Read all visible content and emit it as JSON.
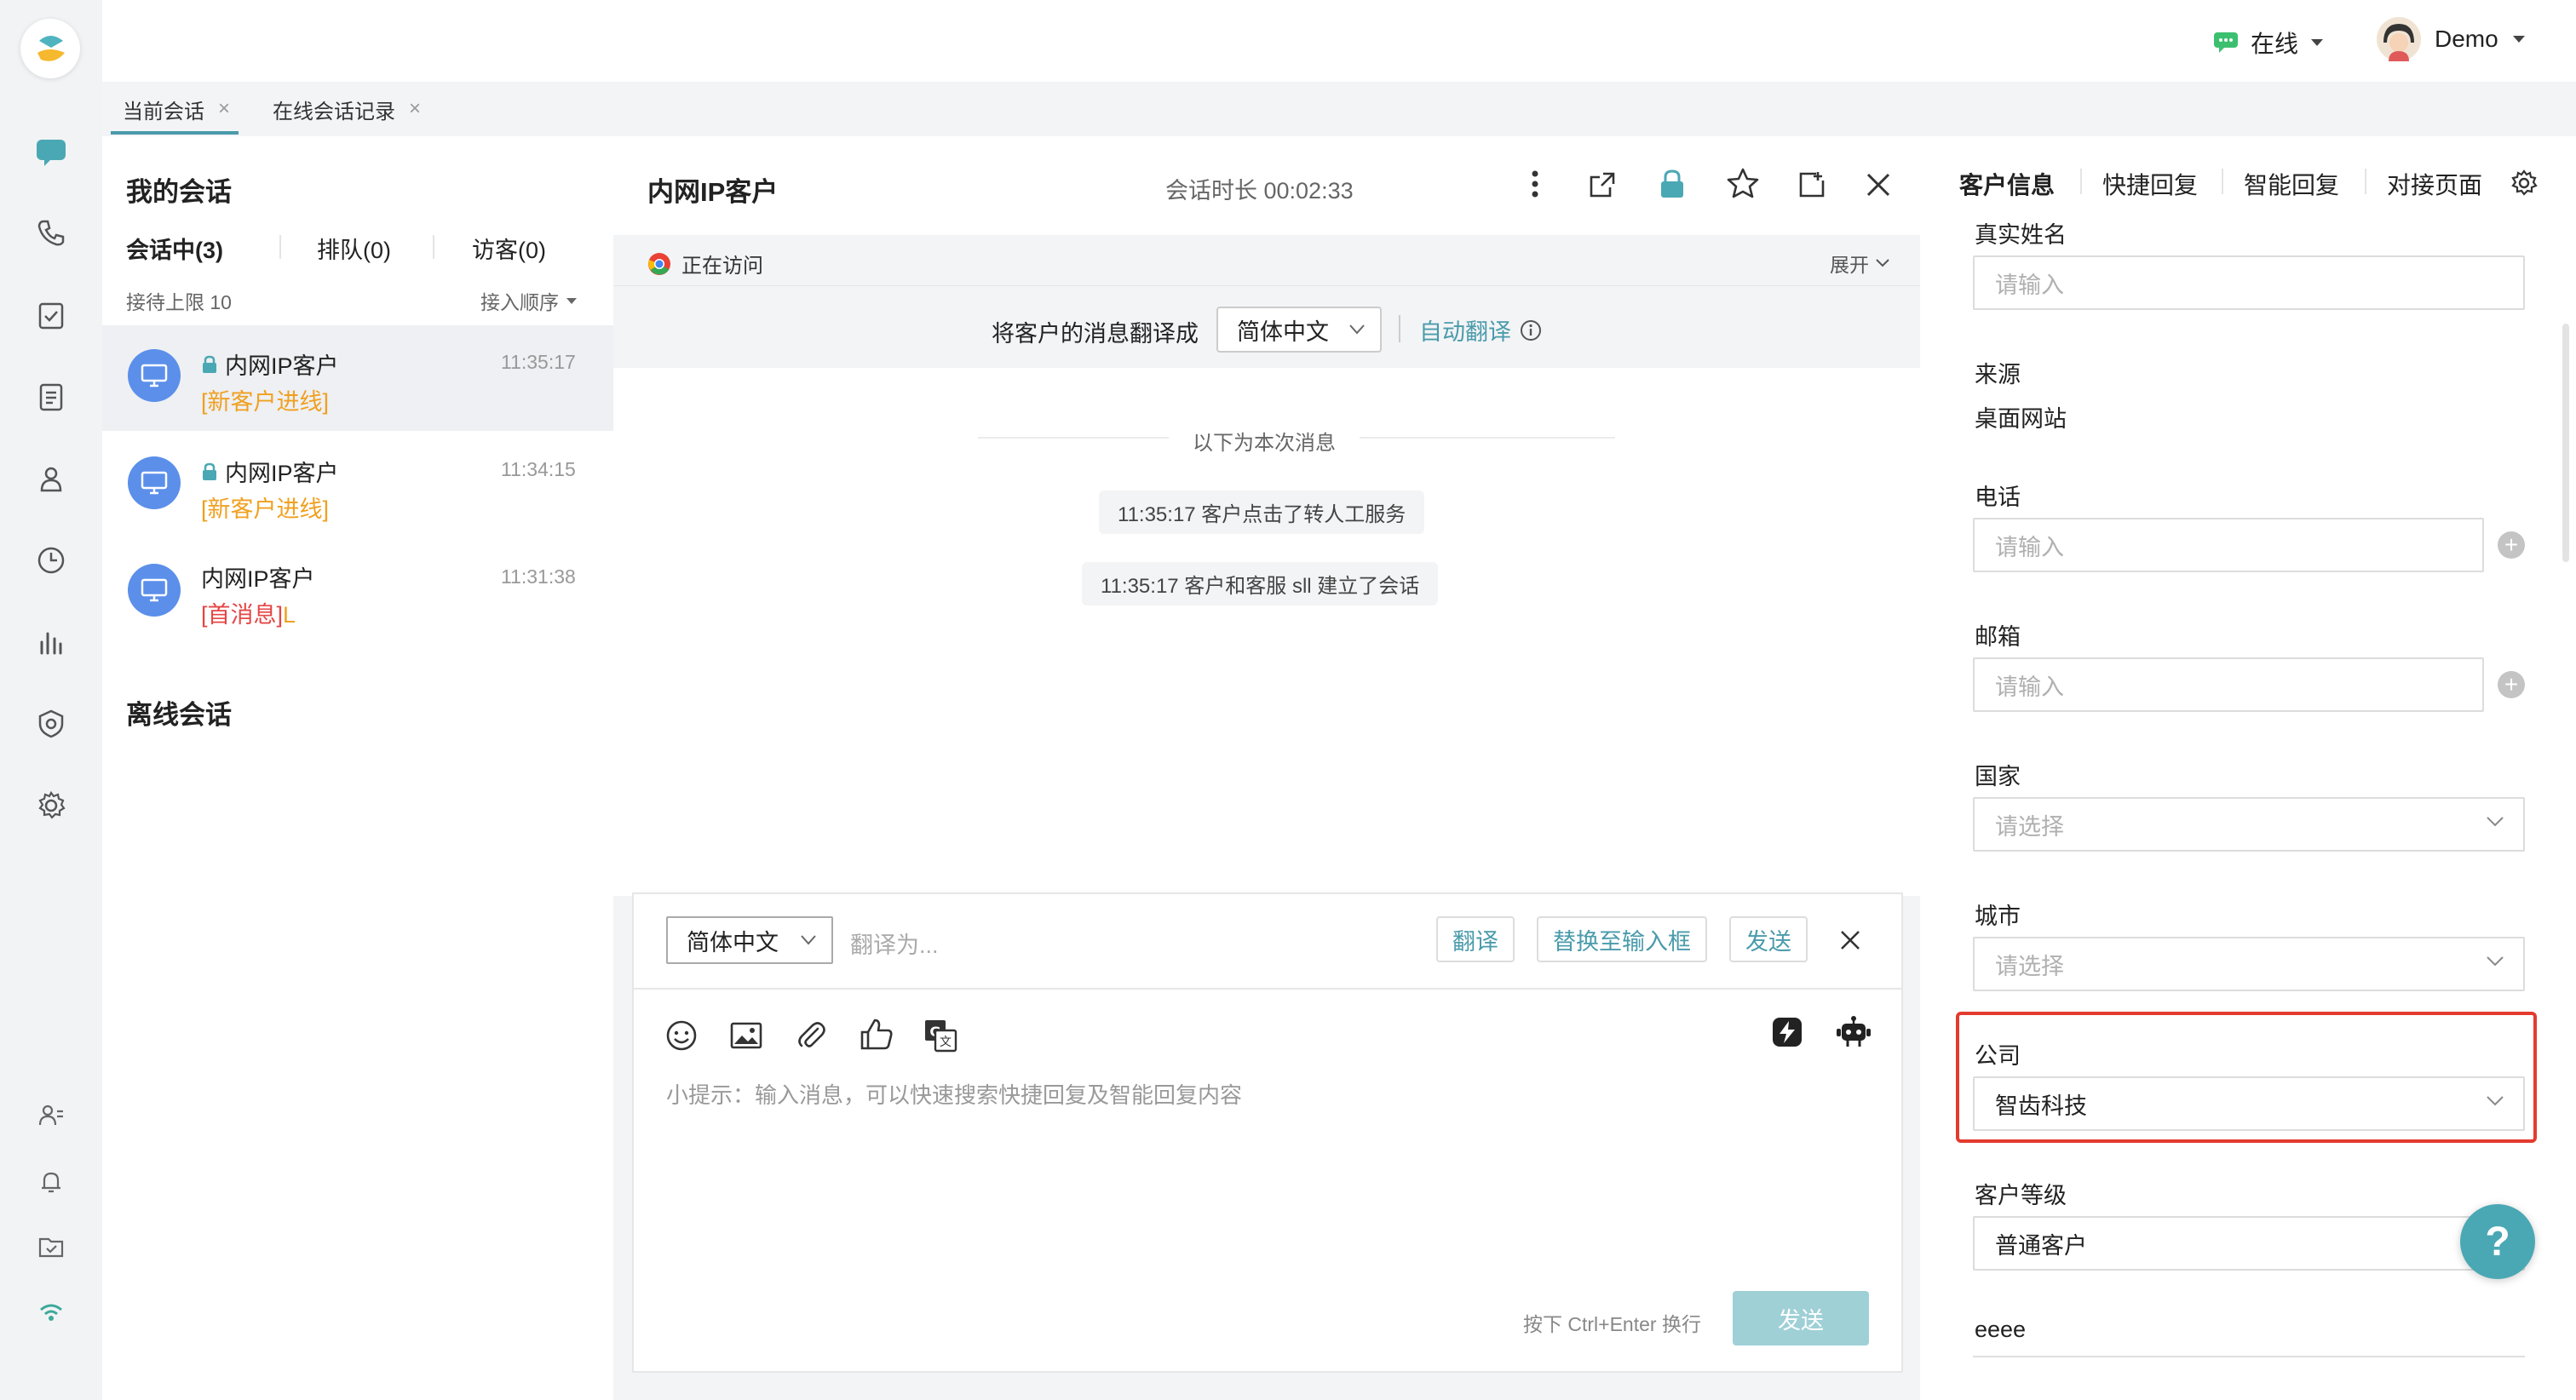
{
  "header": {
    "status_label": "在线",
    "user_name": "Demo"
  },
  "tabs": [
    {
      "label": "当前会话",
      "close": "×"
    },
    {
      "label": "在线会话记录",
      "close": "×"
    }
  ],
  "convlist": {
    "title": "我的会话",
    "subtabs": [
      "会话中(3)",
      "排队(0)",
      "访客(0)"
    ],
    "limit": "接待上限 10",
    "order": "接入顺序",
    "items": [
      {
        "name": "内网IP客户",
        "tag": "[新客户进线]",
        "time": "11:35:17"
      },
      {
        "name": "内网IP客户",
        "tag": "[新客户进线]",
        "time": "11:34:15"
      },
      {
        "name": "内网IP客户",
        "tag": "[首消息]",
        "tag_suffix": "L",
        "time": "11:31:38"
      }
    ],
    "offline_title": "离线会话"
  },
  "chat": {
    "title": "内网IP客户",
    "duration": "会话时长 00:02:33",
    "visiting": "正在访问",
    "expand": "展开",
    "translate_prefix": "将客户的消息翻译成",
    "translate_lang": "简体中文",
    "auto_translate": "自动翻译",
    "separator": "以下为本次消息",
    "system_messages": [
      "11:35:17 客户点击了转人工服务",
      "11:35:17 客户和客服 sll 建立了会话"
    ],
    "trans_lang": "简体中文",
    "trans_placeholder": "翻译为...",
    "btn_translate": "翻译",
    "btn_replace": "替换至输入框",
    "btn_send_trans": "发送",
    "input_hint": "小提示：输入消息，可以快速搜索快捷回复及智能回复内容",
    "enter_hint": "按下 Ctrl+Enter 换行",
    "send": "发送"
  },
  "right": {
    "tabs": [
      "客户信息",
      "快捷回复",
      "智能回复",
      "对接页面"
    ],
    "fields": {
      "realname_label": "真实姓名",
      "realname_placeholder": "请输入",
      "source_label": "来源",
      "source_value": "桌面网站",
      "phone_label": "电话",
      "phone_placeholder": "请输入",
      "email_label": "邮箱",
      "email_placeholder": "请输入",
      "country_label": "国家",
      "country_placeholder": "请选择",
      "city_label": "城市",
      "city_placeholder": "请选择",
      "company_label": "公司",
      "company_value": "智齿科技",
      "level_label": "客户等级",
      "level_value": "普通客户",
      "extra_label": "eeee"
    },
    "help": "?"
  },
  "colors": {
    "accent": "#4a9bab",
    "online": "#3cc06f",
    "highlight": "#e33b2e",
    "tag_orange": "#f0a020",
    "tag_red": "#e64545"
  }
}
